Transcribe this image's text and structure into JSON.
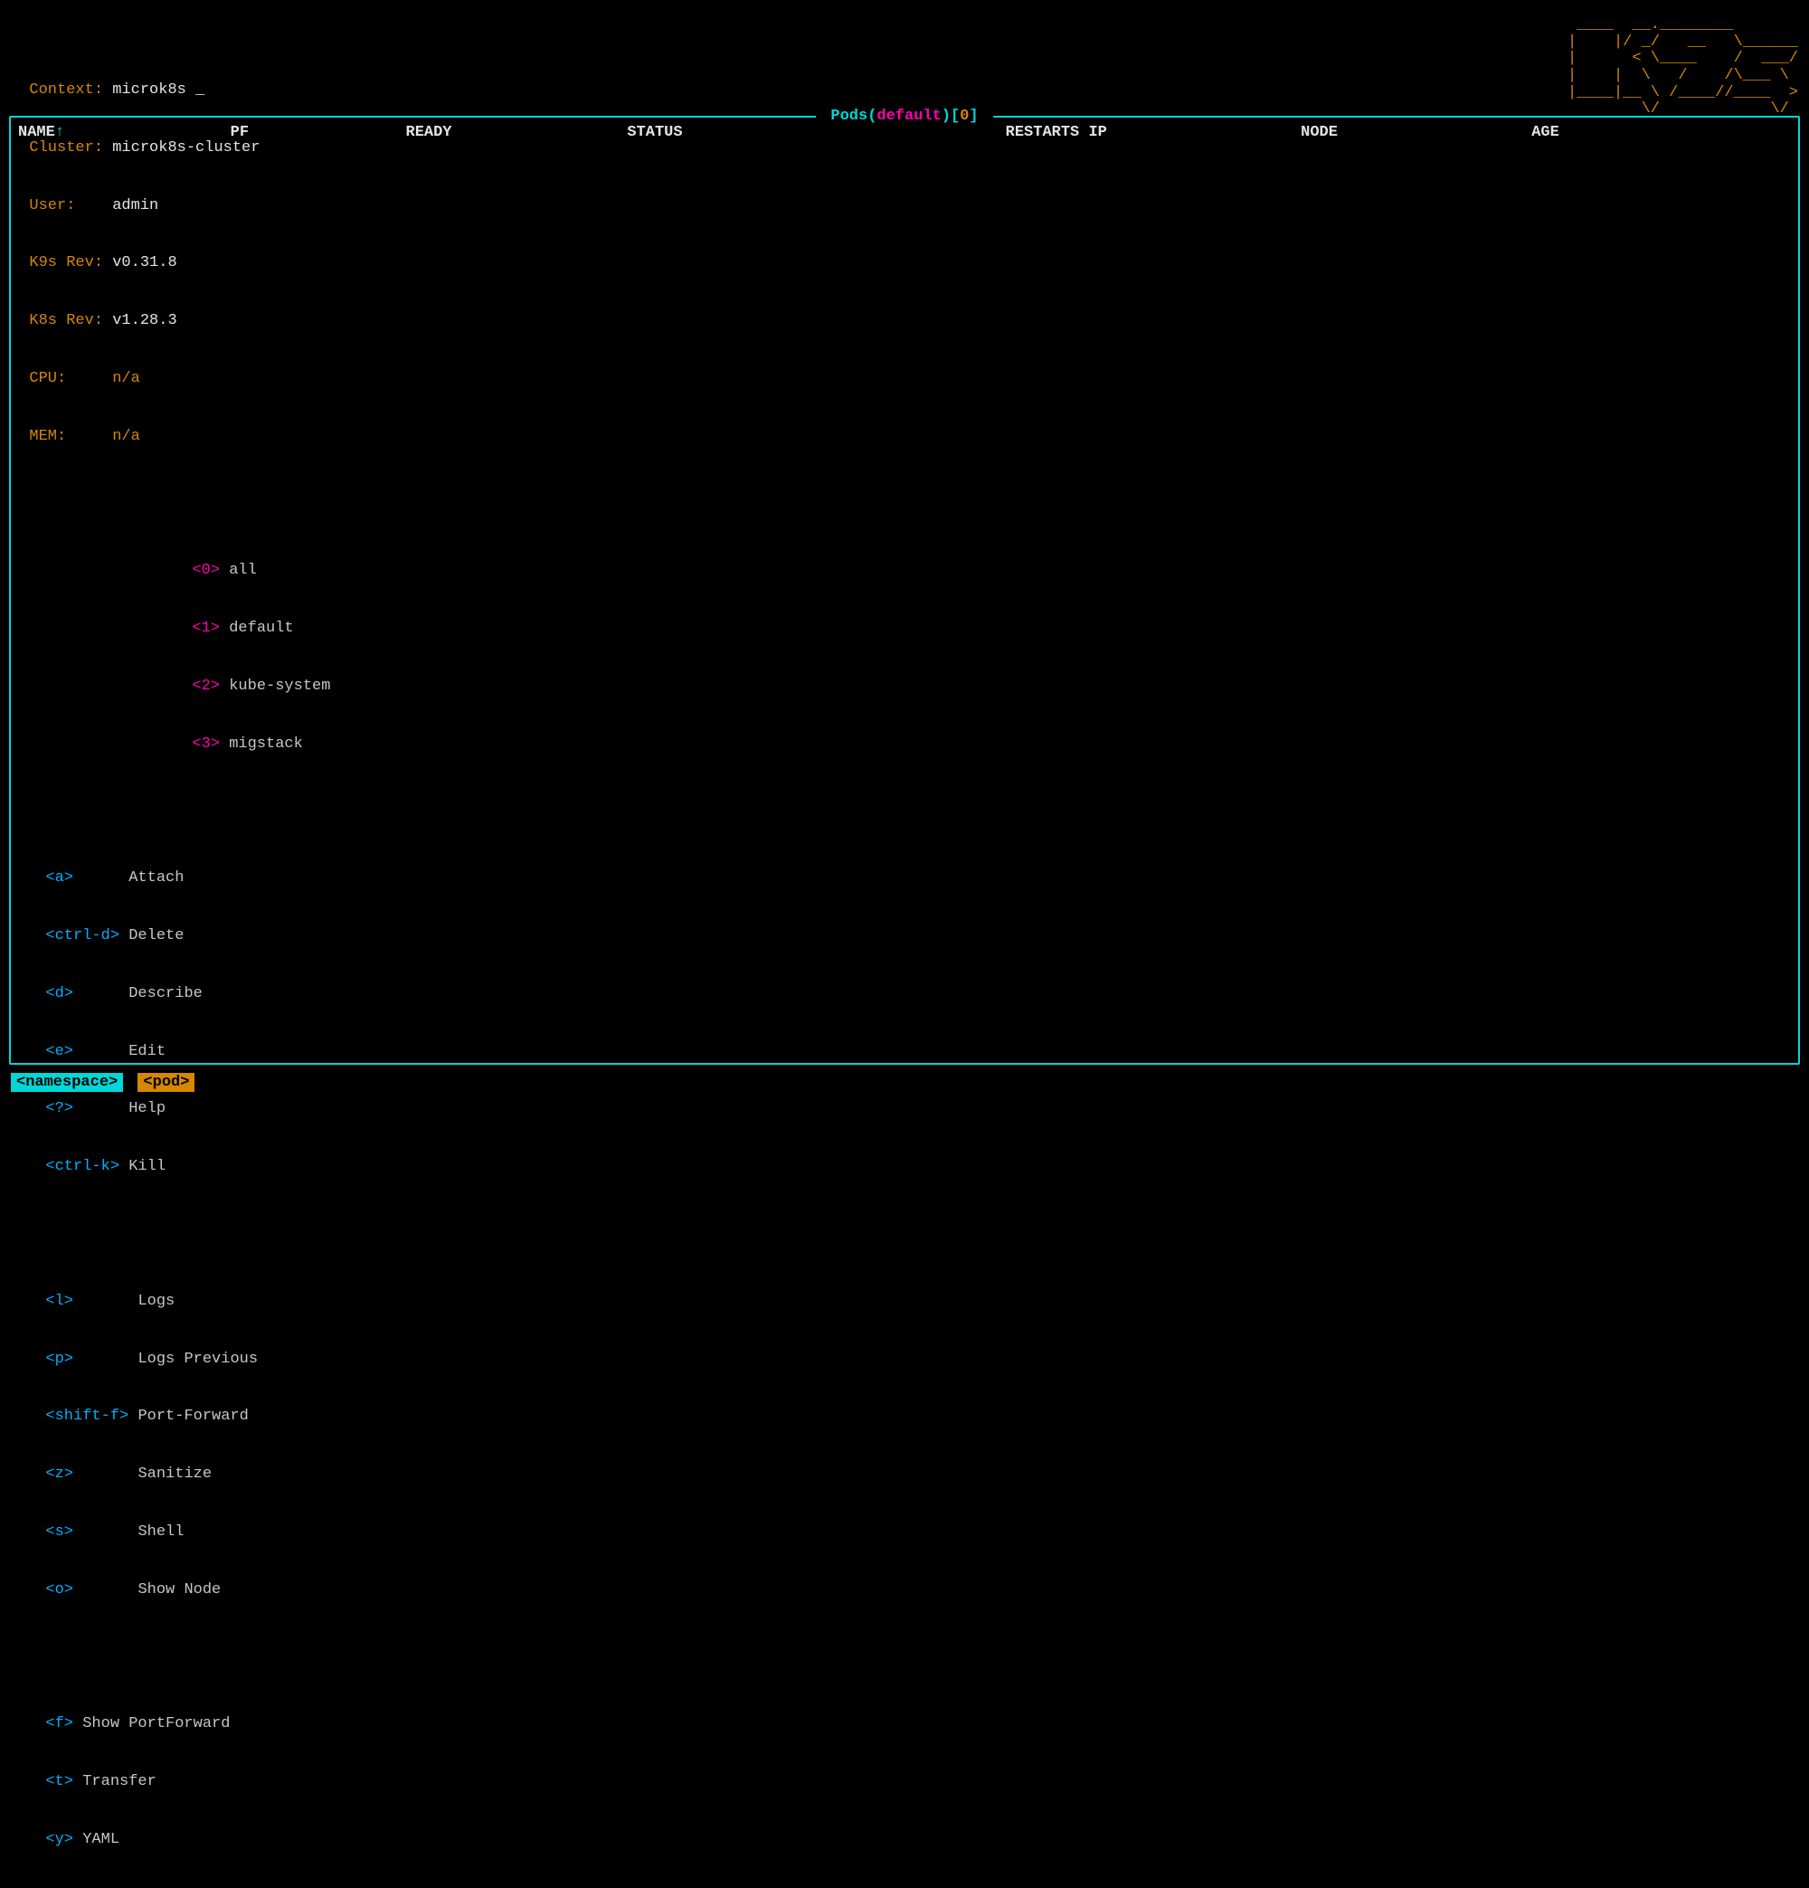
{
  "info": {
    "context_label": "Context:",
    "context_value": "microk8s",
    "cursor": "_",
    "cluster_label": "Cluster:",
    "cluster_value": "microk8s-cluster",
    "user_label": "User:",
    "user_value": "admin",
    "k9srev_label": "K9s Rev:",
    "k9srev_value": "v0.31.8",
    "k8srev_label": "K8s Rev:",
    "k8srev_value": "v1.28.3",
    "cpu_label": "CPU:",
    "cpu_value": "n/a",
    "mem_label": "MEM:",
    "mem_value": "n/a"
  },
  "namespaces": [
    {
      "key": "<0>",
      "label": "all"
    },
    {
      "key": "<1>",
      "label": "default"
    },
    {
      "key": "<2>",
      "label": "kube-system"
    },
    {
      "key": "<3>",
      "label": "migstack"
    }
  ],
  "hints_col1": [
    {
      "key": "<a>",
      "label": "Attach"
    },
    {
      "key": "<ctrl-d>",
      "label": "Delete"
    },
    {
      "key": "<d>",
      "label": "Describe"
    },
    {
      "key": "<e>",
      "label": "Edit"
    },
    {
      "key": "<?>",
      "label": "Help"
    },
    {
      "key": "<ctrl-k>",
      "label": "Kill"
    }
  ],
  "hints_col2": [
    {
      "key": "<l>",
      "label": "Logs"
    },
    {
      "key": "<p>",
      "label": "Logs Previous"
    },
    {
      "key": "<shift-f>",
      "label": "Port-Forward"
    },
    {
      "key": "<z>",
      "label": "Sanitize"
    },
    {
      "key": "<s>",
      "label": "Shell"
    },
    {
      "key": "<o>",
      "label": "Show Node"
    }
  ],
  "hints_col3": [
    {
      "key": "<f>",
      "label": "Show PortForward"
    },
    {
      "key": "<t>",
      "label": "Transfer"
    },
    {
      "key": "<y>",
      "label": "YAML"
    }
  ],
  "logo": " ____  __.________       \n|    |/ _/   __   \\______\n|      < \\____    /  ___/\n|    |  \\   /    /\\___ \\ \n|____|__ \\ /____//____  >\n        \\/            \\/ ",
  "frame": {
    "title_resource": "Pods",
    "title_open": "(",
    "title_ns": "default",
    "title_close": ")[",
    "title_count": "0",
    "title_end": "]"
  },
  "columns": {
    "name": "NAME",
    "arrow": "↑",
    "pf": "PF",
    "ready": "READY",
    "status": "STATUS",
    "restarts": "RESTARTS",
    "ip": "IP",
    "node": "NODE",
    "age": "AGE"
  },
  "crumbs": {
    "namespace": "<namespace>",
    "pod": "<pod>"
  }
}
